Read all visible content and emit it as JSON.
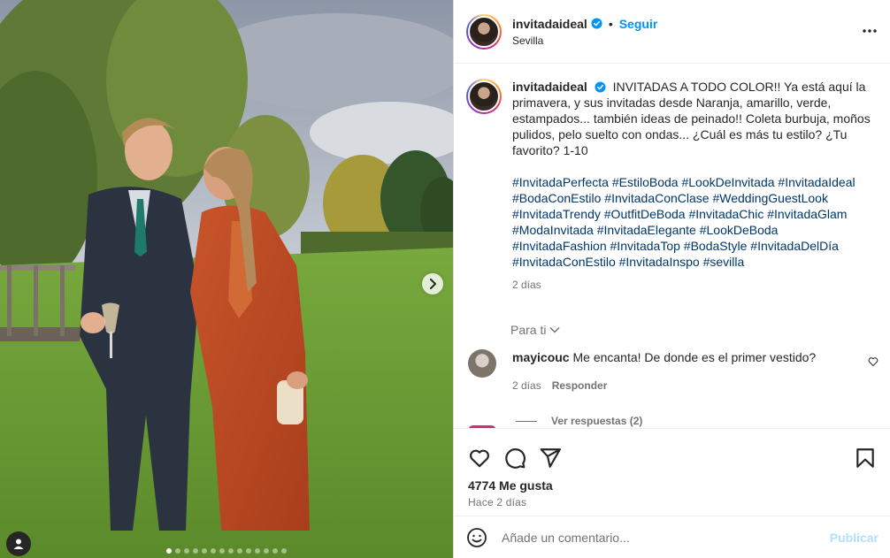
{
  "header": {
    "username": "invitadaideal",
    "separator": "•",
    "follow_label": "Seguir",
    "location": "Sevilla"
  },
  "caption": {
    "username": "invitadaideal",
    "text": "INVITADAS A TODO COLOR!! Ya está aquí la primavera, y sus invitadas desde Naranja, amarillo, verde, estampados... también ideas de peinado!! Coleta burbuja, moños pulidos, pelo suelto con ondas... ¿Cuál es más tu estilo? ¿Tu favorito? 1-10",
    "hashtags": "#InvitadaPerfecta #EstiloBoda #LookDeInvitada #InvitadaIdeal #BodaConEstilo #InvitadaConClase #WeddingGuestLook #InvitadaTrendy #OutfitDeBoda #InvitadaChic #InvitadaGlam #ModaInvitada #InvitadaElegante #LookDeBoda #InvitadaFashion #InvitadaTop #BodaStyle #InvitadaDelDía #InvitadaConEstilo #InvitadaInspo #sevilla",
    "time": "2 días"
  },
  "see_more_label": "Para ti",
  "comment": {
    "username": "mayicouc",
    "text": "Me encanta! De donde es el primer vestido?",
    "time": "2 días",
    "reply_label": "Responder",
    "view_replies": "Ver respuestas (2)"
  },
  "stats": {
    "likes": "4774 Me gusta",
    "ago": "Hace 2 días"
  },
  "composer": {
    "placeholder": "Añade un comentario...",
    "post_label": "Publicar"
  },
  "carousel": {
    "current": 1,
    "total": 14
  },
  "icons": {
    "verified": "verified-badge-icon",
    "more": "more-options-icon",
    "like": "heart-icon",
    "comment": "comment-icon",
    "share": "share-icon",
    "save": "bookmark-icon",
    "emoji": "emoji-icon",
    "next": "chevron-right-icon",
    "tags": "user-tag-icon"
  },
  "colors": {
    "accent": "#0095f6",
    "hashtag": "#00376b",
    "muted": "#737373",
    "post_disabled": "#b2dffc"
  }
}
